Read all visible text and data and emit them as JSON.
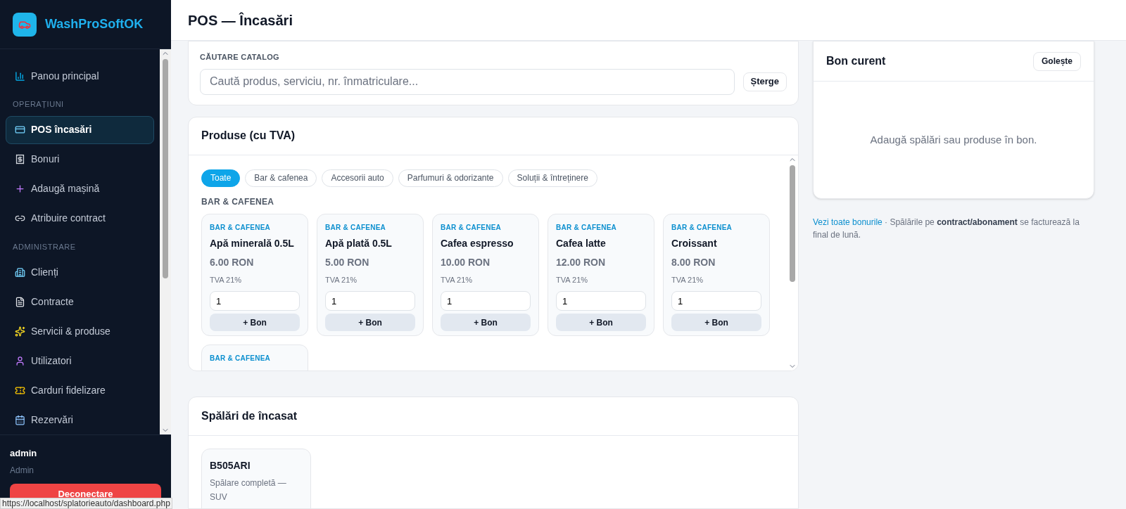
{
  "brand": {
    "name": "WashProSoftOK"
  },
  "sidebar": {
    "items": [
      {
        "kind": "link",
        "label": "Panou principal",
        "selected": false
      },
      {
        "kind": "section",
        "label": "OPERAȚIUNI"
      },
      {
        "kind": "link",
        "label": "POS încasări",
        "selected": true
      },
      {
        "kind": "link",
        "label": "Bonuri",
        "selected": false
      },
      {
        "kind": "link",
        "label": "Adaugă mașină",
        "selected": false
      },
      {
        "kind": "link",
        "label": "Atribuire contract",
        "selected": false
      },
      {
        "kind": "section",
        "label": "ADMINISTRARE"
      },
      {
        "kind": "link",
        "label": "Clienți",
        "selected": false
      },
      {
        "kind": "link",
        "label": "Contracte",
        "selected": false
      },
      {
        "kind": "link",
        "label": "Servicii & produse",
        "selected": false
      },
      {
        "kind": "link",
        "label": "Utilizatori",
        "selected": false
      },
      {
        "kind": "link",
        "label": "Carduri fidelizare",
        "selected": false
      },
      {
        "kind": "link",
        "label": "Rezervări",
        "selected": false
      }
    ],
    "user": {
      "name": "admin",
      "role": "Admin"
    },
    "logout": "Deconectare"
  },
  "header": {
    "title": "POS — Încasări"
  },
  "search": {
    "label": "CĂUTARE CATALOG",
    "placeholder": "Caută produs, serviciu, nr. înmatriculare...",
    "clear": "Șterge"
  },
  "products": {
    "title": "Produse (cu TVA)",
    "filters": [
      {
        "label": "Toate",
        "selected": true
      },
      {
        "label": "Bar & cafenea",
        "selected": false
      },
      {
        "label": "Accesorii auto",
        "selected": false
      },
      {
        "label": "Parfumuri & odorizante",
        "selected": false
      },
      {
        "label": "Soluții & întreținere",
        "selected": false
      }
    ],
    "section": "BAR & CAFENEA",
    "items": [
      {
        "category": "BAR & CAFENEA",
        "name": "Apă minerală 0.5L",
        "price": "6.00 RON",
        "vat": "TVA 21%",
        "qty": "1",
        "button": "+ Bon"
      },
      {
        "category": "BAR & CAFENEA",
        "name": "Apă plată 0.5L",
        "price": "5.00 RON",
        "vat": "TVA 21%",
        "qty": "1",
        "button": "+ Bon"
      },
      {
        "category": "BAR & CAFENEA",
        "name": "Cafea espresso",
        "price": "10.00 RON",
        "vat": "TVA 21%",
        "qty": "1",
        "button": "+ Bon"
      },
      {
        "category": "BAR & CAFENEA",
        "name": "Cafea latte",
        "price": "12.00 RON",
        "vat": "TVA 21%",
        "qty": "1",
        "button": "+ Bon"
      },
      {
        "category": "BAR & CAFENEA",
        "name": "Croissant",
        "price": "8.00 RON",
        "vat": "TVA 21%",
        "qty": "1",
        "button": "+ Bon"
      },
      {
        "category": "BAR & CAFENEA"
      }
    ]
  },
  "washes": {
    "title": "Spălări de încasat",
    "items": [
      {
        "plate": "B505ARI",
        "service": "Spălare completă — SUV"
      }
    ]
  },
  "receipt": {
    "title": "Bon curent",
    "clear": "Golește",
    "empty": "Adaugă spălări sau produse în bon.",
    "link": "Vezi toate bonurile",
    "note": " · Spălările pe **contract/abonament** se facturează la final de lună."
  },
  "status_bar": {
    "url": "https://localhost/splatorieauto/dashboard.php"
  }
}
